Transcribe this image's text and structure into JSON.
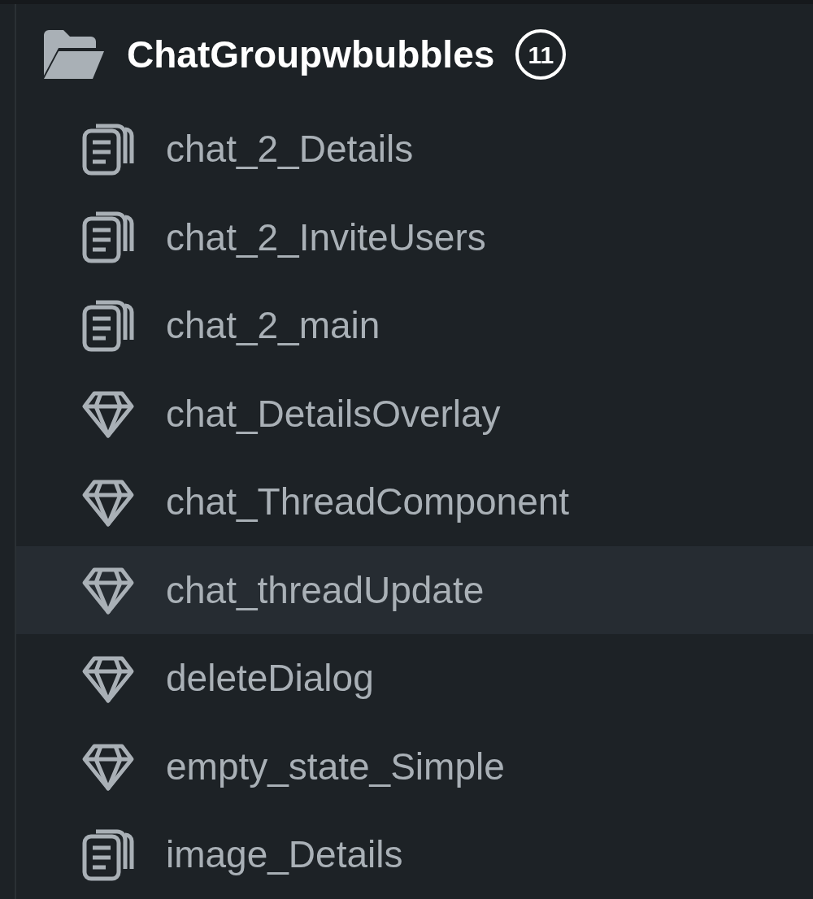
{
  "folder": {
    "name": "ChatGroupwbubbles",
    "count": "11",
    "expanded": true
  },
  "items": [
    {
      "label": "chat_2_Details",
      "kind": "page",
      "selected": false
    },
    {
      "label": "chat_2_InviteUsers",
      "kind": "page",
      "selected": false
    },
    {
      "label": "chat_2_main",
      "kind": "page",
      "selected": false
    },
    {
      "label": "chat_DetailsOverlay",
      "kind": "component",
      "selected": false
    },
    {
      "label": "chat_ThreadComponent",
      "kind": "component",
      "selected": false
    },
    {
      "label": "chat_threadUpdate",
      "kind": "component",
      "selected": true
    },
    {
      "label": "deleteDialog",
      "kind": "component",
      "selected": false
    },
    {
      "label": "empty_state_Simple",
      "kind": "component",
      "selected": false
    },
    {
      "label": "image_Details",
      "kind": "page",
      "selected": false
    }
  ]
}
